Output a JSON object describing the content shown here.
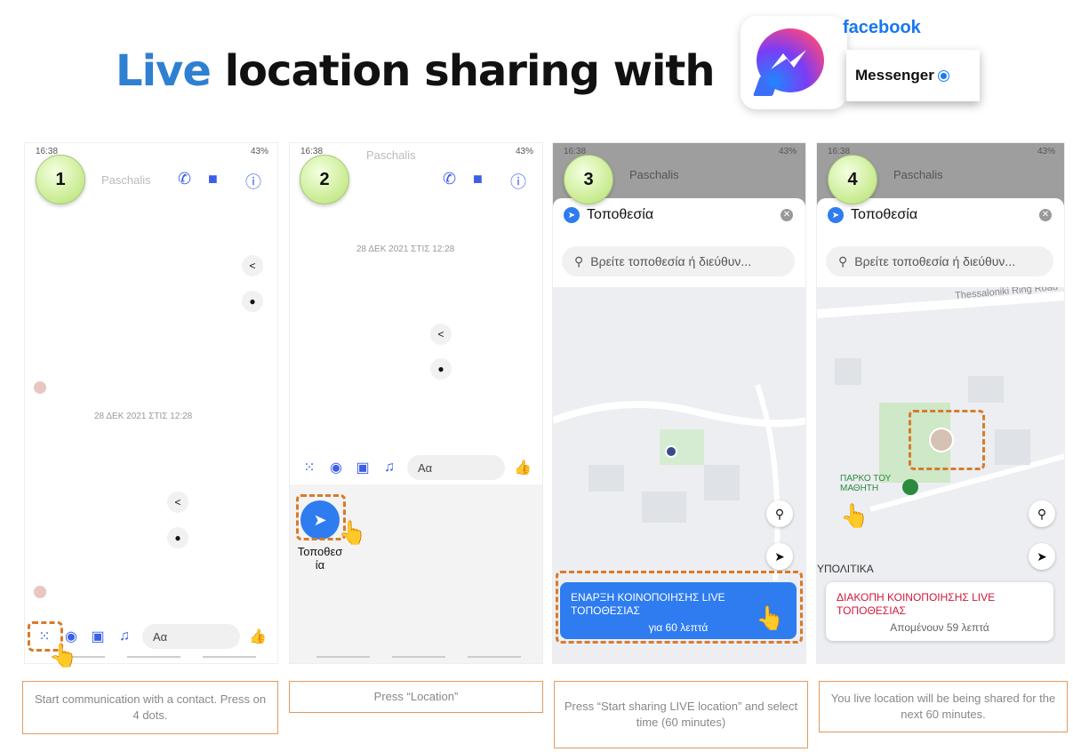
{
  "header": {
    "title_highlight": "Live",
    "title_rest": " location sharing with",
    "brand_top": "facebook",
    "brand_name": "Messenger"
  },
  "phones": [
    {
      "step": "1",
      "status_time": "16:38",
      "status_right": "43%",
      "contact": "Paschalis",
      "date_label": "28 ΔΕΚ 2021 ΣΤΙΣ 12:28",
      "composer_placeholder": "Αα",
      "caption": "Start communication with a contact. Press on 4 dots."
    },
    {
      "step": "2",
      "status_time": "16:38",
      "status_right": "43%",
      "contact": "Paschalis",
      "date_label": "28 ΔΕΚ 2021 ΣΤΙΣ 12:28",
      "composer_placeholder": "Αα",
      "location_label": "Τοποθεσ\nία",
      "caption": "Press “Location”"
    },
    {
      "step": "3",
      "status_time": "16:38",
      "status_right": "43%",
      "contact": "Paschalis",
      "sheet_title": "Τοποθεσία",
      "search_placeholder": "Βρείτε τοποθεσία ή διεύθυν...",
      "start_button_line1": "ΕΝΑΡΞΗ ΚΟΙΝΟΠΟΙΗΣΗΣ LIVE",
      "start_button_line2": "ΤΟΠΟΘΕΣΙΑΣ",
      "start_button_sub": "για 60 λεπτά",
      "caption": "Press “Start sharing LIVE location” and select time (60 minutes)"
    },
    {
      "step": "4",
      "status_time": "16:38",
      "status_right": "43%",
      "contact": "Paschalis",
      "sheet_title": "Τοποθεσία",
      "search_placeholder": "Βρείτε τοποθεσία ή διεύθυν...",
      "road_label": "Thessaloniki Ring Road",
      "park_label": "ΠΑΡΚΟ ΤΟΥ ΜΑΘΗΤΗ",
      "area_label": "ΥΠΟΛΙΤΙΚΑ",
      "stop_line1": "ΔΙΑΚΟΠΗ ΚΟΙΝΟΠΟΙΗΣΗΣ LIVE",
      "stop_line2": "ΤΟΠΟΘΕΣΙΑΣ",
      "stop_sub": "Απομένουν 59 λεπτά",
      "caption": "You live location will be being shared for the next 60 minutes."
    }
  ]
}
